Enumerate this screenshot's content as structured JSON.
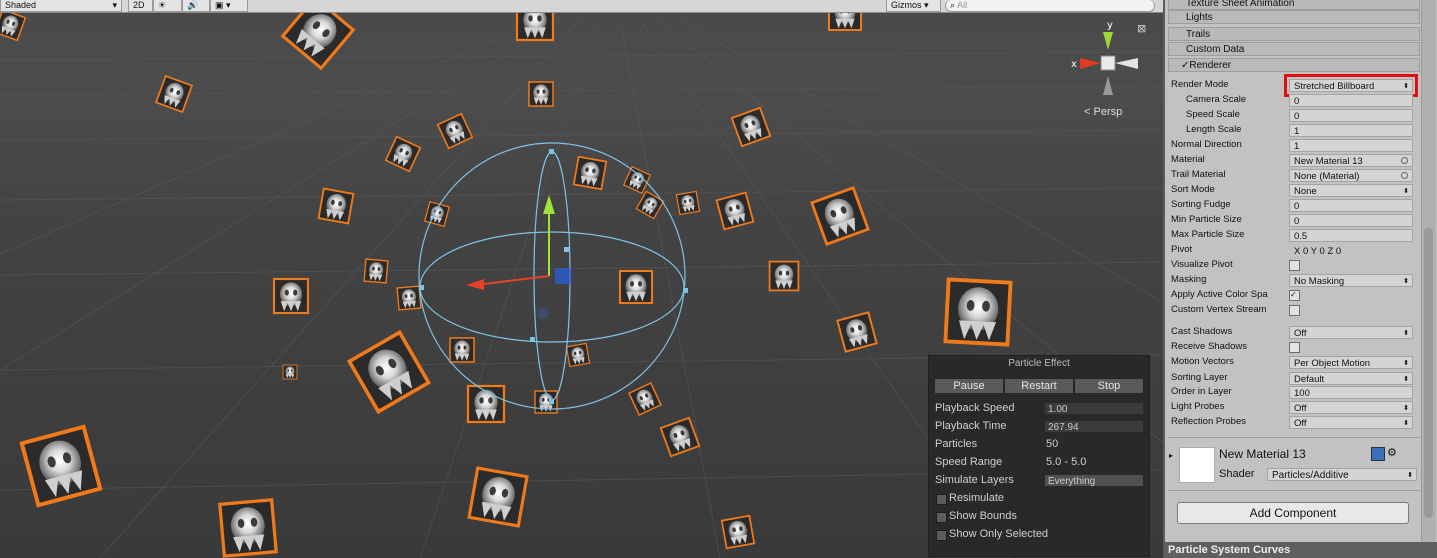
{
  "toolbar": {
    "draw_mode": "Shaded",
    "mode_2d": "2D",
    "gizmos": "Gizmos",
    "search_placeholder": "All"
  },
  "gizmo": {
    "y_label": "y",
    "x_label": "x",
    "persp_label": "Persp"
  },
  "particle_effect": {
    "title": "Particle Effect",
    "buttons": [
      "Pause",
      "Restart",
      "Stop"
    ],
    "rows": [
      {
        "label": "Playback Speed",
        "value": "1.00"
      },
      {
        "label": "Playback Time",
        "value": "267.94"
      },
      {
        "label": "Particles",
        "value": "50"
      },
      {
        "label": "Speed Range",
        "value": "5.0 - 5.0"
      },
      {
        "label": "Simulate Layers",
        "value": "Everything"
      }
    ],
    "checks": [
      "Resimulate",
      "Show Bounds",
      "Show Only Selected"
    ]
  },
  "inspector": {
    "modules": [
      "Texture Sheet Animation",
      "Lights",
      "Trails",
      "Custom Data",
      "Renderer"
    ],
    "renderer_checked": true,
    "fields": [
      {
        "label": "Render Mode",
        "value": "Stretched Billboard",
        "kind": "dropdown",
        "highlight": true
      },
      {
        "label": "Camera Scale",
        "value": "0",
        "kind": "text",
        "indent": true
      },
      {
        "label": "Speed Scale",
        "value": "0",
        "kind": "text",
        "indent": true
      },
      {
        "label": "Length Scale",
        "value": "1",
        "kind": "text",
        "indent": true
      },
      {
        "label": "Normal Direction",
        "value": "1",
        "kind": "text"
      },
      {
        "label": "Material",
        "value": "New Material 13",
        "kind": "object"
      },
      {
        "label": "Trail Material",
        "value": "None (Material)",
        "kind": "object"
      },
      {
        "label": "Sort Mode",
        "value": "None",
        "kind": "dropdown"
      },
      {
        "label": "Sorting Fudge",
        "value": "0",
        "kind": "text"
      },
      {
        "label": "Min Particle Size",
        "value": "0",
        "kind": "text"
      },
      {
        "label": "Max Particle Size",
        "value": "0.5",
        "kind": "text"
      },
      {
        "label": "Pivot",
        "value": "X  0  Y  0  Z  0",
        "kind": "plain"
      },
      {
        "label": "Visualize Pivot",
        "value": "",
        "kind": "check",
        "checked": false
      },
      {
        "label": "Masking",
        "value": "No Masking",
        "kind": "dropdown"
      },
      {
        "label": "Apply Active Color Spa",
        "value": "",
        "kind": "check",
        "checked": true
      },
      {
        "label": "Custom Vertex Stream",
        "value": "",
        "kind": "check",
        "checked": false
      },
      {
        "label": "Cast Shadows",
        "value": "Off",
        "kind": "dropdown"
      },
      {
        "label": "Receive Shadows",
        "value": "",
        "kind": "check",
        "checked": false
      },
      {
        "label": "Motion Vectors",
        "value": "Per Object Motion",
        "kind": "dropdown"
      },
      {
        "label": "Sorting Layer",
        "value": "Default",
        "kind": "dropdown"
      },
      {
        "label": "Order in Layer",
        "value": "100",
        "kind": "text"
      },
      {
        "label": "Light Probes",
        "value": "Off",
        "kind": "dropdown"
      },
      {
        "label": "Reflection Probes",
        "value": "Off",
        "kind": "dropdown"
      }
    ],
    "material": {
      "name": "New Material 13",
      "shader_label": "Shader",
      "shader": "Particles/Additive"
    },
    "add_component": "Add Component",
    "curves_title": "Particle System Curves"
  },
  "colors": {
    "selection_outline": "#f07a1a",
    "highlight_box": "#e01010",
    "sphere_gizmo": "#7ec3e6"
  }
}
